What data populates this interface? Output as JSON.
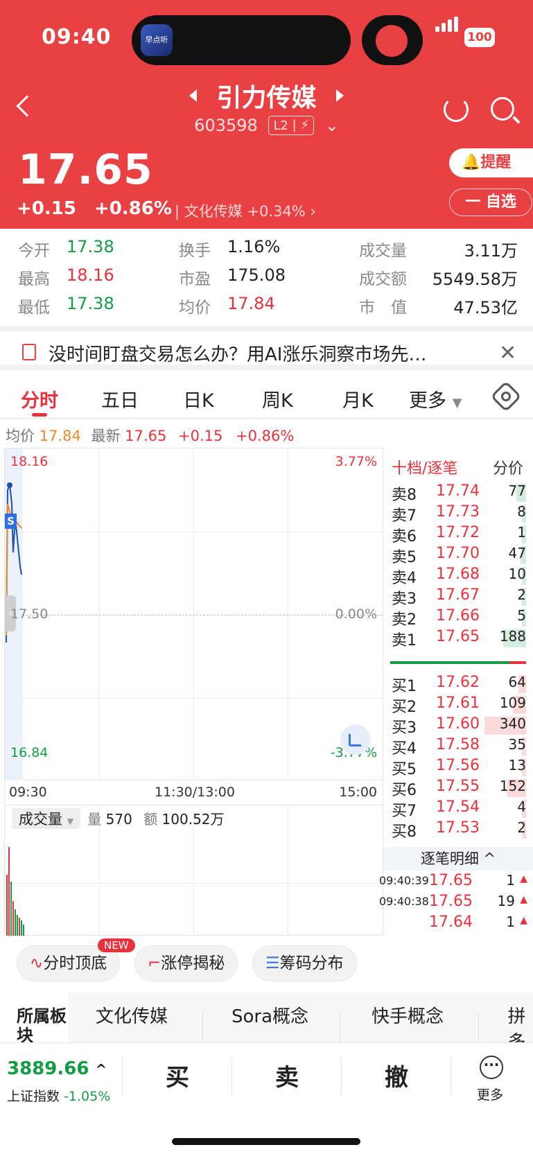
{
  "status": {
    "time": "09:40",
    "battery": "100",
    "island_app": "早点听"
  },
  "header": {
    "title": "引力传媒",
    "code": "603598",
    "badge": "L2",
    "price": "17.65",
    "change": "+0.15",
    "change_pct": "+0.86%",
    "sector": "文化传媒",
    "sector_pct": "+0.34%",
    "remind_label": "提醒",
    "fav_label": "一 自选"
  },
  "stats": [
    {
      "k": "今开",
      "v": "17.38",
      "c": "green"
    },
    {
      "k": "换手",
      "v": "1.16%",
      "c": "black"
    },
    {
      "k": "成交量",
      "v": "3.11万",
      "c": "black"
    },
    {
      "k": "最高",
      "v": "18.16",
      "c": "red"
    },
    {
      "k": "市盈",
      "v": "175.08",
      "c": "black"
    },
    {
      "k": "成交额",
      "v": "5549.58万",
      "c": "black"
    },
    {
      "k": "最低",
      "v": "17.38",
      "c": "green"
    },
    {
      "k": "均价",
      "v": "17.84",
      "c": "red"
    },
    {
      "k": "市　值",
      "v": "47.53亿",
      "c": "black"
    }
  ],
  "banner": {
    "text": "没时间盯盘交易怎么办？用AI涨乐洞察市场先…",
    "close": "✕"
  },
  "tabs": [
    "分时",
    "五日",
    "日K",
    "周K",
    "月K",
    "更多"
  ],
  "info": {
    "avg_label": "均价",
    "avg": "17.84",
    "last_label": "最新",
    "last": "17.65",
    "chg": "+0.15",
    "pct": "+0.86%"
  },
  "chart": {
    "y_top": "18.16",
    "y_mid": "17.50",
    "y_bot": "16.84",
    "pct_top": "3.77%",
    "pct_mid": "0.00%",
    "pct_bot": "-3.77%",
    "x_start": "09:30",
    "x_mid": "11:30/13:00",
    "x_end": "15:00",
    "marker": "S"
  },
  "volume": {
    "tag": "成交量",
    "vol_label": "量",
    "vol": "570",
    "amt_label": "额",
    "amt": "100.52万"
  },
  "orderbook": {
    "head": "十档/逐笔",
    "head2": "分价",
    "asks": [
      {
        "l": "卖8",
        "p": "17.74",
        "q": "77"
      },
      {
        "l": "卖7",
        "p": "17.73",
        "q": "8"
      },
      {
        "l": "卖6",
        "p": "17.72",
        "q": "1"
      },
      {
        "l": "卖5",
        "p": "17.70",
        "q": "47"
      },
      {
        "l": "卖4",
        "p": "17.68",
        "q": "10"
      },
      {
        "l": "卖3",
        "p": "17.67",
        "q": "2"
      },
      {
        "l": "卖2",
        "p": "17.66",
        "q": "5"
      },
      {
        "l": "卖1",
        "p": "17.65",
        "q": "188"
      }
    ],
    "bids": [
      {
        "l": "买1",
        "p": "17.62",
        "q": "64"
      },
      {
        "l": "买2",
        "p": "17.61",
        "q": "109"
      },
      {
        "l": "买3",
        "p": "17.60",
        "q": "340"
      },
      {
        "l": "买4",
        "p": "17.58",
        "q": "35"
      },
      {
        "l": "买5",
        "p": "17.56",
        "q": "13"
      },
      {
        "l": "买6",
        "p": "17.55",
        "q": "152"
      },
      {
        "l": "买7",
        "p": "17.54",
        "q": "4"
      },
      {
        "l": "买8",
        "p": "17.53",
        "q": "2"
      }
    ],
    "detail_label": "逐笔明细 ^",
    "ticks": [
      {
        "t": "09:40:39",
        "p": "17.65",
        "q": "1"
      },
      {
        "t": "09:40:38",
        "p": "17.65",
        "q": "19"
      },
      {
        "t": "",
        "p": "17.64",
        "q": "1"
      }
    ]
  },
  "tools": [
    "分时顶底",
    "涨停揭秘",
    "筹码分布"
  ],
  "new_tag": "NEW",
  "plates": {
    "label": "所属板块",
    "items": [
      "文化传媒",
      "Sora概念",
      "快手概念",
      "拼多"
    ]
  },
  "bottom": {
    "index_value": "3889.66",
    "index_name": "上证指数",
    "index_pct": "-1.05%",
    "buy": "买",
    "sell": "卖",
    "cancel": "撤",
    "more": "更多"
  }
}
